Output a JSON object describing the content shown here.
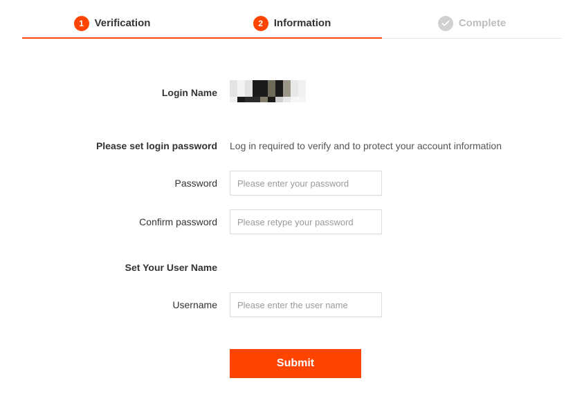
{
  "stepper": {
    "step1": {
      "num": "1",
      "label": "Verification"
    },
    "step2": {
      "num": "2",
      "label": "Information"
    },
    "step3": {
      "label": "Complete"
    }
  },
  "form": {
    "login_name_label": "Login Name",
    "section_password_title": "Please set login password",
    "section_password_hint": "Log in required to verify and to protect your account information",
    "password_label": "Password",
    "password_placeholder": "Please enter your password",
    "confirm_label": "Confirm password",
    "confirm_placeholder": "Please retype your password",
    "section_username_title": "Set Your User Name",
    "username_label": "Username",
    "username_placeholder": "Please enter the user name",
    "submit_label": "Submit"
  }
}
